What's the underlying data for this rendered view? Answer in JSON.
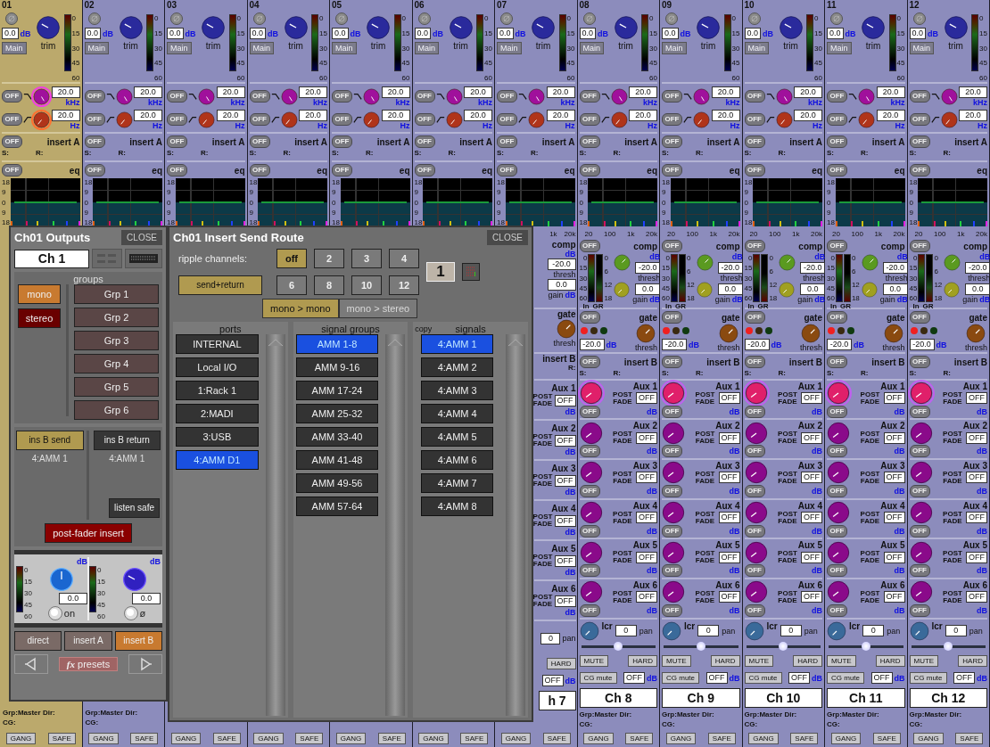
{
  "channels": [
    {
      "number": "01",
      "selected": true,
      "trim": {
        "value": "0.0",
        "unit": "dB",
        "main": "Main",
        "label": "trim",
        "scale": [
          "0",
          "15",
          "30",
          "45",
          "60"
        ]
      },
      "filters": [
        {
          "off": "OFF",
          "value": "20.0",
          "unit": "kHz",
          "kind": "high"
        },
        {
          "off": "OFF",
          "value": "20.0",
          "unit": "Hz",
          "kind": "low"
        }
      ],
      "insert_a": {
        "off": "OFF",
        "label": "insert A",
        "send": "S:",
        "return": "R:"
      },
      "eq": {
        "off": "OFF",
        "label": "eq",
        "scale": [
          "18",
          "9",
          "0",
          "9",
          "18"
        ]
      },
      "footer": {
        "grp": "Grp:Master Dir:",
        "cg": "CG:",
        "gang": "GANG",
        "safe": "SAFE"
      }
    },
    {
      "number": "02",
      "selected": false,
      "trim": {
        "value": "0.0",
        "unit": "dB",
        "main": "Main",
        "label": "trim",
        "scale": [
          "0",
          "15",
          "30",
          "45",
          "60"
        ]
      },
      "filters": [
        {
          "off": "OFF",
          "value": "20.0",
          "unit": "kHz",
          "kind": "high"
        },
        {
          "off": "OFF",
          "value": "20.0",
          "unit": "Hz",
          "kind": "low"
        }
      ],
      "insert_a": {
        "off": "OFF",
        "label": "insert A",
        "send": "S:",
        "return": "R:"
      },
      "eq": {
        "off": "OFF",
        "label": "eq",
        "scale": [
          "18",
          "9",
          "0",
          "9",
          "18"
        ]
      },
      "footer": {
        "grp": "Grp:Master Dir:",
        "cg": "CG:",
        "gang": "GANG",
        "safe": "SAFE"
      }
    },
    {
      "number": "03",
      "selected": false,
      "trim": {
        "value": "0.0",
        "unit": "dB",
        "main": "Main",
        "label": "trim",
        "scale": [
          "0",
          "15",
          "30",
          "45",
          "60"
        ]
      },
      "filters": [
        {
          "off": "OFF",
          "value": "20.0",
          "unit": "kHz",
          "kind": "high"
        },
        {
          "off": "OFF",
          "value": "20.0",
          "unit": "Hz",
          "kind": "low"
        }
      ],
      "insert_a": {
        "off": "OFF",
        "label": "insert A",
        "send": "S:",
        "return": "R:"
      },
      "eq": {
        "off": "OFF",
        "label": "eq",
        "scale": [
          "18",
          "9",
          "0",
          "9",
          "18"
        ]
      },
      "footer": {
        "gang": "GANG",
        "safe": "SAFE"
      }
    },
    {
      "number": "04",
      "selected": false,
      "trim": {
        "value": "0.0",
        "unit": "dB",
        "main": "Main",
        "label": "trim",
        "scale": [
          "0",
          "15",
          "30",
          "45",
          "60"
        ]
      },
      "filters": [
        {
          "off": "OFF",
          "value": "20.0",
          "unit": "kHz",
          "kind": "high"
        },
        {
          "off": "OFF",
          "value": "20.0",
          "unit": "Hz",
          "kind": "low"
        }
      ],
      "insert_a": {
        "off": "OFF",
        "label": "insert A",
        "send": "S:",
        "return": "R:"
      },
      "eq": {
        "off": "OFF",
        "label": "eq",
        "scale": [
          "18",
          "9",
          "0",
          "9",
          "18"
        ]
      },
      "footer": {
        "gang": "GANG",
        "safe": "SAFE"
      }
    },
    {
      "number": "05",
      "selected": false,
      "trim": {
        "value": "0.0",
        "unit": "dB",
        "main": "Main",
        "label": "trim",
        "scale": [
          "0",
          "15",
          "30",
          "45",
          "60"
        ]
      },
      "filters": [
        {
          "off": "OFF",
          "value": "20.0",
          "unit": "kHz",
          "kind": "high"
        },
        {
          "off": "OFF",
          "value": "20.0",
          "unit": "Hz",
          "kind": "low"
        }
      ],
      "insert_a": {
        "off": "OFF",
        "label": "insert A",
        "send": "S:",
        "return": "R:"
      },
      "eq": {
        "off": "OFF",
        "label": "eq",
        "scale": [
          "18",
          "9",
          "0",
          "9",
          "18"
        ]
      },
      "footer": {
        "gang": "GANG",
        "safe": "SAFE"
      }
    },
    {
      "number": "06",
      "selected": false,
      "trim": {
        "value": "0.0",
        "unit": "dB",
        "main": "Main",
        "label": "trim",
        "scale": [
          "0",
          "15",
          "30",
          "45",
          "60"
        ]
      },
      "filters": [
        {
          "off": "OFF",
          "value": "20.0",
          "unit": "kHz",
          "kind": "high"
        },
        {
          "off": "OFF",
          "value": "20.0",
          "unit": "Hz",
          "kind": "low"
        }
      ],
      "insert_a": {
        "off": "OFF",
        "label": "insert A",
        "send": "S:",
        "return": "R:"
      },
      "eq": {
        "off": "OFF",
        "label": "eq",
        "scale": [
          "18",
          "9",
          "0",
          "9",
          "18"
        ]
      },
      "footer": {
        "gang": "GANG",
        "safe": "SAFE"
      }
    },
    {
      "number": "07",
      "selected": false,
      "trim": {
        "value": "0.0",
        "unit": "dB",
        "main": "Main",
        "label": "trim",
        "scale": [
          "0",
          "15",
          "30",
          "45",
          "60"
        ]
      },
      "filters": [
        {
          "off": "OFF",
          "value": "20.0",
          "unit": "kHz",
          "kind": "high"
        },
        {
          "off": "OFF",
          "value": "20.0",
          "unit": "Hz",
          "kind": "low"
        }
      ],
      "insert_a": {
        "off": "OFF",
        "label": "insert A",
        "send": "S:",
        "return": "R:"
      },
      "eq": {
        "off": "OFF",
        "label": "eq",
        "scale": [
          "18",
          "9",
          "0",
          "9",
          "18"
        ]
      },
      "lower": {
        "partial": true,
        "freq_scale": [
          "1k",
          "20k"
        ],
        "comp": {
          "label": "comp",
          "unit": "dB",
          "thresh": "-20.0",
          "thresh_label": "thresh",
          "gain": "0.0",
          "gain_label": "gain",
          "gain_unit": "dB"
        },
        "gate": {
          "label": "gate",
          "thresh_label": "thresh"
        },
        "insert_b": {
          "label": "insert B",
          "return": "R:"
        },
        "auxes": [
          {
            "label": "Aux 1",
            "post_fade": "POST FADE",
            "value": "OFF",
            "unit": "dB",
            "selected": false
          },
          {
            "label": "Aux 2",
            "post_fade": "POST FADE",
            "value": "OFF",
            "unit": "dB",
            "selected": false
          },
          {
            "label": "Aux 3",
            "post_fade": "POST FADE",
            "value": "OFF",
            "unit": "dB",
            "selected": false
          },
          {
            "label": "Aux 4",
            "post_fade": "POST FADE",
            "value": "OFF",
            "unit": "dB",
            "selected": false
          },
          {
            "label": "Aux 5",
            "post_fade": "POST FADE",
            "value": "OFF",
            "unit": "dB",
            "selected": false
          },
          {
            "label": "Aux 6",
            "post_fade": "POST FADE",
            "value": "OFF",
            "unit": "dB",
            "selected": false
          }
        ],
        "pan": {
          "value": "0",
          "unit": "pan"
        },
        "hard": "HARD",
        "cg_value": "OFF",
        "cg_unit": "dB",
        "name": "h 7"
      },
      "footer": {
        "gang": "GANG",
        "safe": "SAFE"
      }
    },
    {
      "number": "08",
      "selected": false,
      "trim": {
        "value": "0.0",
        "unit": "dB",
        "main": "Main",
        "label": "trim",
        "scale": [
          "0",
          "15",
          "30",
          "45",
          "60"
        ]
      },
      "filters": [
        {
          "off": "OFF",
          "value": "20.0",
          "unit": "kHz",
          "kind": "high"
        },
        {
          "off": "OFF",
          "value": "20.0",
          "unit": "Hz",
          "kind": "low"
        }
      ],
      "insert_a": {
        "off": "OFF",
        "label": "insert A",
        "send": "S:",
        "return": "R:"
      },
      "eq": {
        "off": "OFF",
        "label": "eq",
        "scale": [
          "18",
          "9",
          "0",
          "9",
          "18"
        ]
      },
      "lower": {
        "freq_scale": [
          "20",
          "100",
          "1k",
          "20k"
        ],
        "comp": {
          "off": "OFF",
          "label": "comp",
          "unit": "dB",
          "in_scale": [
            "0",
            "15",
            "30",
            "45",
            "60"
          ],
          "gr_scale": [
            "0",
            "6",
            "12",
            "18"
          ],
          "in": "In",
          "gr": "GR",
          "thresh": "-20.0",
          "thresh_label": "thresh",
          "gain": "0.0",
          "gain_label": "gain",
          "gain_unit": "dB"
        },
        "gate": {
          "off": "OFF",
          "label": "gate",
          "value": "-20.0",
          "unit": "dB",
          "thresh_label": "thresh"
        },
        "insert_b": {
          "off": "OFF",
          "label": "insert B",
          "send": "S:",
          "return": "R:"
        },
        "auxes": [
          {
            "label": "Aux 1",
            "post_fade": "POST FADE",
            "value": "OFF",
            "off": "OFF",
            "unit": "dB",
            "selected": true
          },
          {
            "label": "Aux 2",
            "post_fade": "POST FADE",
            "value": "OFF",
            "off": "OFF",
            "unit": "dB",
            "selected": false
          },
          {
            "label": "Aux 3",
            "post_fade": "POST FADE",
            "value": "OFF",
            "off": "OFF",
            "unit": "dB",
            "selected": false
          },
          {
            "label": "Aux 4",
            "post_fade": "POST FADE",
            "value": "OFF",
            "off": "OFF",
            "unit": "dB",
            "selected": false
          },
          {
            "label": "Aux 5",
            "post_fade": "POST FADE",
            "value": "OFF",
            "off": "OFF",
            "unit": "dB",
            "selected": false
          },
          {
            "label": "Aux 6",
            "post_fade": "POST FADE",
            "value": "OFF",
            "off": "OFF",
            "unit": "dB",
            "selected": false
          }
        ],
        "pan": {
          "label": "lcr",
          "value": "0",
          "unit": "pan",
          "level": 0.5
        },
        "mute": "MUTE",
        "hard": "HARD",
        "cg_mute": "CG mute",
        "cg_value": "OFF",
        "cg_unit": "dB",
        "name": "Ch 8"
      },
      "footer": {
        "grp": "Grp:Master Dir:",
        "cg": "CG:",
        "gang": "GANG",
        "safe": "SAFE"
      }
    },
    {
      "number": "09",
      "selected": false,
      "trim": {
        "value": "0.0",
        "unit": "dB",
        "main": "Main",
        "label": "trim",
        "scale": [
          "0",
          "15",
          "30",
          "45",
          "60"
        ]
      },
      "filters": [
        {
          "off": "OFF",
          "value": "20.0",
          "unit": "kHz",
          "kind": "high"
        },
        {
          "off": "OFF",
          "value": "20.0",
          "unit": "Hz",
          "kind": "low"
        }
      ],
      "insert_a": {
        "off": "OFF",
        "label": "insert A",
        "send": "S:",
        "return": "R:"
      },
      "eq": {
        "off": "OFF",
        "label": "eq",
        "scale": [
          "18",
          "9",
          "0",
          "9",
          "18"
        ]
      },
      "lower": {
        "freq_scale": [
          "20",
          "100",
          "1k",
          "20k"
        ],
        "comp": {
          "off": "OFF",
          "label": "comp",
          "unit": "dB",
          "in_scale": [
            "0",
            "15",
            "30",
            "45",
            "60"
          ],
          "gr_scale": [
            "0",
            "6",
            "12",
            "18"
          ],
          "in": "In",
          "gr": "GR",
          "thresh": "-20.0",
          "thresh_label": "thresh",
          "gain": "0.0",
          "gain_label": "gain",
          "gain_unit": "dB"
        },
        "gate": {
          "off": "OFF",
          "label": "gate",
          "value": "-20.0",
          "unit": "dB",
          "thresh_label": "thresh"
        },
        "insert_b": {
          "off": "OFF",
          "label": "insert B",
          "send": "S:",
          "return": "R:"
        },
        "auxes": [
          {
            "label": "Aux 1",
            "post_fade": "POST FADE",
            "value": "OFF",
            "off": "OFF",
            "unit": "dB",
            "selected": true
          },
          {
            "label": "Aux 2",
            "post_fade": "POST FADE",
            "value": "OFF",
            "off": "OFF",
            "unit": "dB",
            "selected": false
          },
          {
            "label": "Aux 3",
            "post_fade": "POST FADE",
            "value": "OFF",
            "off": "OFF",
            "unit": "dB",
            "selected": false
          },
          {
            "label": "Aux 4",
            "post_fade": "POST FADE",
            "value": "OFF",
            "off": "OFF",
            "unit": "dB",
            "selected": false
          },
          {
            "label": "Aux 5",
            "post_fade": "POST FADE",
            "value": "OFF",
            "off": "OFF",
            "unit": "dB",
            "selected": false
          },
          {
            "label": "Aux 6",
            "post_fade": "POST FADE",
            "value": "OFF",
            "off": "OFF",
            "unit": "dB",
            "selected": false
          }
        ],
        "pan": {
          "label": "lcr",
          "value": "0",
          "unit": "pan",
          "level": 0.5
        },
        "mute": "MUTE",
        "hard": "HARD",
        "cg_mute": "CG mute",
        "cg_value": "OFF",
        "cg_unit": "dB",
        "name": "Ch 9"
      },
      "footer": {
        "grp": "Grp:Master Dir:",
        "cg": "CG:",
        "gang": "GANG",
        "safe": "SAFE"
      }
    },
    {
      "number": "10",
      "selected": false,
      "trim": {
        "value": "0.0",
        "unit": "dB",
        "main": "Main",
        "label": "trim",
        "scale": [
          "0",
          "15",
          "30",
          "45",
          "60"
        ]
      },
      "filters": [
        {
          "off": "OFF",
          "value": "20.0",
          "unit": "kHz",
          "kind": "high"
        },
        {
          "off": "OFF",
          "value": "20.0",
          "unit": "Hz",
          "kind": "low"
        }
      ],
      "insert_a": {
        "off": "OFF",
        "label": "insert A",
        "send": "S:",
        "return": "R:"
      },
      "eq": {
        "off": "OFF",
        "label": "eq",
        "scale": [
          "18",
          "9",
          "0",
          "9",
          "18"
        ]
      },
      "lower": {
        "freq_scale": [
          "20",
          "100",
          "1k",
          "20k"
        ],
        "comp": {
          "off": "OFF",
          "label": "comp",
          "unit": "dB",
          "in_scale": [
            "0",
            "15",
            "30",
            "45",
            "60"
          ],
          "gr_scale": [
            "0",
            "6",
            "12",
            "18"
          ],
          "in": "In",
          "gr": "GR",
          "thresh": "-20.0",
          "thresh_label": "thresh",
          "gain": "0.0",
          "gain_label": "gain",
          "gain_unit": "dB"
        },
        "gate": {
          "off": "OFF",
          "label": "gate",
          "value": "-20.0",
          "unit": "dB",
          "thresh_label": "thresh"
        },
        "insert_b": {
          "off": "OFF",
          "label": "insert B",
          "send": "S:",
          "return": "R:"
        },
        "auxes": [
          {
            "label": "Aux 1",
            "post_fade": "POST FADE",
            "value": "OFF",
            "off": "OFF",
            "unit": "dB",
            "selected": true
          },
          {
            "label": "Aux 2",
            "post_fade": "POST FADE",
            "value": "OFF",
            "off": "OFF",
            "unit": "dB",
            "selected": false
          },
          {
            "label": "Aux 3",
            "post_fade": "POST FADE",
            "value": "OFF",
            "off": "OFF",
            "unit": "dB",
            "selected": false
          },
          {
            "label": "Aux 4",
            "post_fade": "POST FADE",
            "value": "OFF",
            "off": "OFF",
            "unit": "dB",
            "selected": false
          },
          {
            "label": "Aux 5",
            "post_fade": "POST FADE",
            "value": "OFF",
            "off": "OFF",
            "unit": "dB",
            "selected": false
          },
          {
            "label": "Aux 6",
            "post_fade": "POST FADE",
            "value": "OFF",
            "off": "OFF",
            "unit": "dB",
            "selected": false
          }
        ],
        "pan": {
          "label": "lcr",
          "value": "0",
          "unit": "pan",
          "level": 0.5
        },
        "mute": "MUTE",
        "hard": "HARD",
        "cg_mute": "CG mute",
        "cg_value": "OFF",
        "cg_unit": "dB",
        "name": "Ch 10"
      },
      "footer": {
        "grp": "Grp:Master Dir:",
        "cg": "CG:",
        "gang": "GANG",
        "safe": "SAFE"
      }
    },
    {
      "number": "11",
      "selected": false,
      "trim": {
        "value": "0.0",
        "unit": "dB",
        "main": "Main",
        "label": "trim",
        "scale": [
          "0",
          "15",
          "30",
          "45",
          "60"
        ]
      },
      "filters": [
        {
          "off": "OFF",
          "value": "20.0",
          "unit": "kHz",
          "kind": "high"
        },
        {
          "off": "OFF",
          "value": "20.0",
          "unit": "Hz",
          "kind": "low"
        }
      ],
      "insert_a": {
        "off": "OFF",
        "label": "insert A",
        "send": "S:",
        "return": "R:"
      },
      "eq": {
        "off": "OFF",
        "label": "eq",
        "scale": [
          "18",
          "9",
          "0",
          "9",
          "18"
        ]
      },
      "lower": {
        "freq_scale": [
          "20",
          "100",
          "1k",
          "20k"
        ],
        "comp": {
          "off": "OFF",
          "label": "comp",
          "unit": "dB",
          "in_scale": [
            "0",
            "15",
            "30",
            "45",
            "60"
          ],
          "gr_scale": [
            "0",
            "6",
            "12",
            "18"
          ],
          "in": "In",
          "gr": "GR",
          "thresh": "-20.0",
          "thresh_label": "thresh",
          "gain": "0.0",
          "gain_label": "gain",
          "gain_unit": "dB"
        },
        "gate": {
          "off": "OFF",
          "label": "gate",
          "value": "-20.0",
          "unit": "dB",
          "thresh_label": "thresh"
        },
        "insert_b": {
          "off": "OFF",
          "label": "insert B",
          "send": "S:",
          "return": "R:"
        },
        "auxes": [
          {
            "label": "Aux 1",
            "post_fade": "POST FADE",
            "value": "OFF",
            "off": "OFF",
            "unit": "dB",
            "selected": true
          },
          {
            "label": "Aux 2",
            "post_fade": "POST FADE",
            "value": "OFF",
            "off": "OFF",
            "unit": "dB",
            "selected": false
          },
          {
            "label": "Aux 3",
            "post_fade": "POST FADE",
            "value": "OFF",
            "off": "OFF",
            "unit": "dB",
            "selected": false
          },
          {
            "label": "Aux 4",
            "post_fade": "POST FADE",
            "value": "OFF",
            "off": "OFF",
            "unit": "dB",
            "selected": false
          },
          {
            "label": "Aux 5",
            "post_fade": "POST FADE",
            "value": "OFF",
            "off": "OFF",
            "unit": "dB",
            "selected": false
          },
          {
            "label": "Aux 6",
            "post_fade": "POST FADE",
            "value": "OFF",
            "off": "OFF",
            "unit": "dB",
            "selected": false
          }
        ],
        "pan": {
          "label": "lcr",
          "value": "0",
          "unit": "pan",
          "level": 0.5
        },
        "mute": "MUTE",
        "hard": "HARD",
        "cg_mute": "CG mute",
        "cg_value": "OFF",
        "cg_unit": "dB",
        "name": "Ch 11"
      },
      "footer": {
        "grp": "Grp:Master Dir:",
        "cg": "CG:",
        "gang": "GANG",
        "safe": "SAFE"
      }
    },
    {
      "number": "12",
      "selected": false,
      "trim": {
        "value": "0.0",
        "unit": "dB",
        "main": "Main",
        "label": "trim",
        "scale": [
          "0",
          "15",
          "30",
          "45",
          "60"
        ]
      },
      "filters": [
        {
          "off": "OFF",
          "value": "20.0",
          "unit": "kHz",
          "kind": "high"
        },
        {
          "off": "OFF",
          "value": "20.0",
          "unit": "Hz",
          "kind": "low"
        }
      ],
      "insert_a": {
        "off": "OFF",
        "label": "insert A",
        "send": "S:",
        "return": "R:"
      },
      "eq": {
        "off": "OFF",
        "label": "eq",
        "scale": [
          "18",
          "9",
          "0",
          "9",
          "18"
        ]
      },
      "lower": {
        "freq_scale": [
          "20",
          "100",
          "1k",
          "20k"
        ],
        "comp": {
          "off": "OFF",
          "label": "comp",
          "unit": "dB",
          "in_scale": [
            "0",
            "15",
            "30",
            "45",
            "60"
          ],
          "gr_scale": [
            "0",
            "6",
            "12",
            "18"
          ],
          "in": "In",
          "gr": "GR",
          "thresh": "-20.0",
          "thresh_label": "thresh",
          "gain": "0.0",
          "gain_label": "gain",
          "gain_unit": "dB"
        },
        "gate": {
          "off": "OFF",
          "label": "gate",
          "value": "-20.0",
          "unit": "dB",
          "thresh_label": "thresh"
        },
        "insert_b": {
          "off": "OFF",
          "label": "insert B",
          "send": "S:",
          "return": "R:"
        },
        "auxes": [
          {
            "label": "Aux 1",
            "post_fade": "POST FADE",
            "value": "OFF",
            "off": "OFF",
            "unit": "dB",
            "selected": true
          },
          {
            "label": "Aux 2",
            "post_fade": "POST FADE",
            "value": "OFF",
            "off": "OFF",
            "unit": "dB",
            "selected": false
          },
          {
            "label": "Aux 3",
            "post_fade": "POST FADE",
            "value": "OFF",
            "off": "OFF",
            "unit": "dB",
            "selected": false
          },
          {
            "label": "Aux 4",
            "post_fade": "POST FADE",
            "value": "OFF",
            "off": "OFF",
            "unit": "dB",
            "selected": false
          },
          {
            "label": "Aux 5",
            "post_fade": "POST FADE",
            "value": "OFF",
            "off": "OFF",
            "unit": "dB",
            "selected": false
          },
          {
            "label": "Aux 6",
            "post_fade": "POST FADE",
            "value": "OFF",
            "off": "OFF",
            "unit": "dB",
            "selected": false
          }
        ],
        "pan": {
          "label": "lcr",
          "value": "0",
          "unit": "pan",
          "level": 0.5
        },
        "mute": "MUTE",
        "hard": "HARD",
        "cg_mute": "CG mute",
        "cg_value": "OFF",
        "cg_unit": "dB",
        "name": "Ch 12"
      },
      "footer": {
        "grp": "Grp:Master Dir:",
        "cg": "CG:",
        "gang": "GANG",
        "safe": "SAFE"
      }
    }
  ],
  "outputs_popup": {
    "title": "Ch01 Outputs",
    "close": "CLOSE",
    "channel_name": "Ch 1",
    "groups_label": "groups",
    "bus_buttons": [
      {
        "label": "mono",
        "selected": true
      },
      {
        "label": "stereo",
        "selected": false
      }
    ],
    "groups": [
      {
        "label": "Grp 1",
        "selected": false
      },
      {
        "label": "Grp 2",
        "selected": false
      },
      {
        "label": "Grp 3",
        "selected": false
      },
      {
        "label": "Grp 4",
        "selected": false
      },
      {
        "label": "Grp 5",
        "selected": false
      },
      {
        "label": "Grp 6",
        "selected": false
      }
    ],
    "inserts": [
      {
        "label": "ins B send",
        "value": "4:AMM 1",
        "selected": true
      },
      {
        "label": "ins B return",
        "value": "4:AMM 1",
        "selected": false
      }
    ],
    "listen_safe": "listen safe",
    "post_fader": {
      "label": "post-fader insert",
      "on": true
    },
    "controls": [
      {
        "unit": "dB",
        "value": "0.0",
        "switch": "on",
        "kind": "direct",
        "scale": [
          "0",
          "15",
          "30",
          "45",
          "60"
        ]
      },
      {
        "unit": "dB",
        "value": "0.0",
        "switch": "ø",
        "kind": "insert",
        "scale": [
          "0",
          "15",
          "30",
          "45",
          "60"
        ]
      }
    ],
    "tabs": [
      {
        "label": "direct",
        "selected": false
      },
      {
        "label": "insert A",
        "selected": false
      },
      {
        "label": "insert B",
        "selected": true
      }
    ],
    "presets": {
      "fx": "fx",
      "label": "presets"
    }
  },
  "route_popup": {
    "title": "Ch01 Insert Send Route",
    "close": "CLOSE",
    "ripple_label": "ripple channels:",
    "ripple": [
      {
        "label": "off",
        "selected": true
      },
      {
        "label": "2",
        "selected": false
      },
      {
        "label": "3",
        "selected": false
      },
      {
        "label": "4",
        "selected": false
      },
      {
        "label": "6",
        "selected": false
      },
      {
        "label": "8",
        "selected": false
      },
      {
        "label": "10",
        "selected": false
      },
      {
        "label": "12",
        "selected": false
      }
    ],
    "send_return": {
      "label": "send+return",
      "on": true
    },
    "channel_number": "1",
    "modes": [
      {
        "label": "mono > mono",
        "selected": true
      },
      {
        "label": "mono > stereo",
        "selected": false
      }
    ],
    "lists": [
      {
        "title": "ports",
        "items": [
          {
            "label": "INTERNAL",
            "selected": false
          },
          {
            "label": "Local I/O",
            "selected": false
          },
          {
            "label": "1:Rack 1",
            "selected": false
          },
          {
            "label": "2:MADI",
            "selected": false
          },
          {
            "label": "3:USB",
            "selected": false
          },
          {
            "label": "4:AMM D1",
            "selected": true
          }
        ]
      },
      {
        "title": "signal groups",
        "items": [
          {
            "label": "AMM 1-8",
            "selected": true
          },
          {
            "label": "AMM 9-16",
            "selected": false
          },
          {
            "label": "AMM 17-24",
            "selected": false
          },
          {
            "label": "AMM 25-32",
            "selected": false
          },
          {
            "label": "AMM 33-40",
            "selected": false
          },
          {
            "label": "AMM 41-48",
            "selected": false
          },
          {
            "label": "AMM 49-56",
            "selected": false
          },
          {
            "label": "AMM 57-64",
            "selected": false
          }
        ]
      },
      {
        "title": "signals",
        "copy": "copy",
        "items": [
          {
            "label": "4:AMM 1",
            "selected": true
          },
          {
            "label": "4:AMM 2",
            "selected": false
          },
          {
            "label": "4:AMM 3",
            "selected": false
          },
          {
            "label": "4:AMM 4",
            "selected": false
          },
          {
            "label": "4:AMM 5",
            "selected": false
          },
          {
            "label": "4:AMM 6",
            "selected": false
          },
          {
            "label": "4:AMM 7",
            "selected": false
          },
          {
            "label": "4:AMM 8",
            "selected": false
          }
        ]
      }
    ]
  }
}
